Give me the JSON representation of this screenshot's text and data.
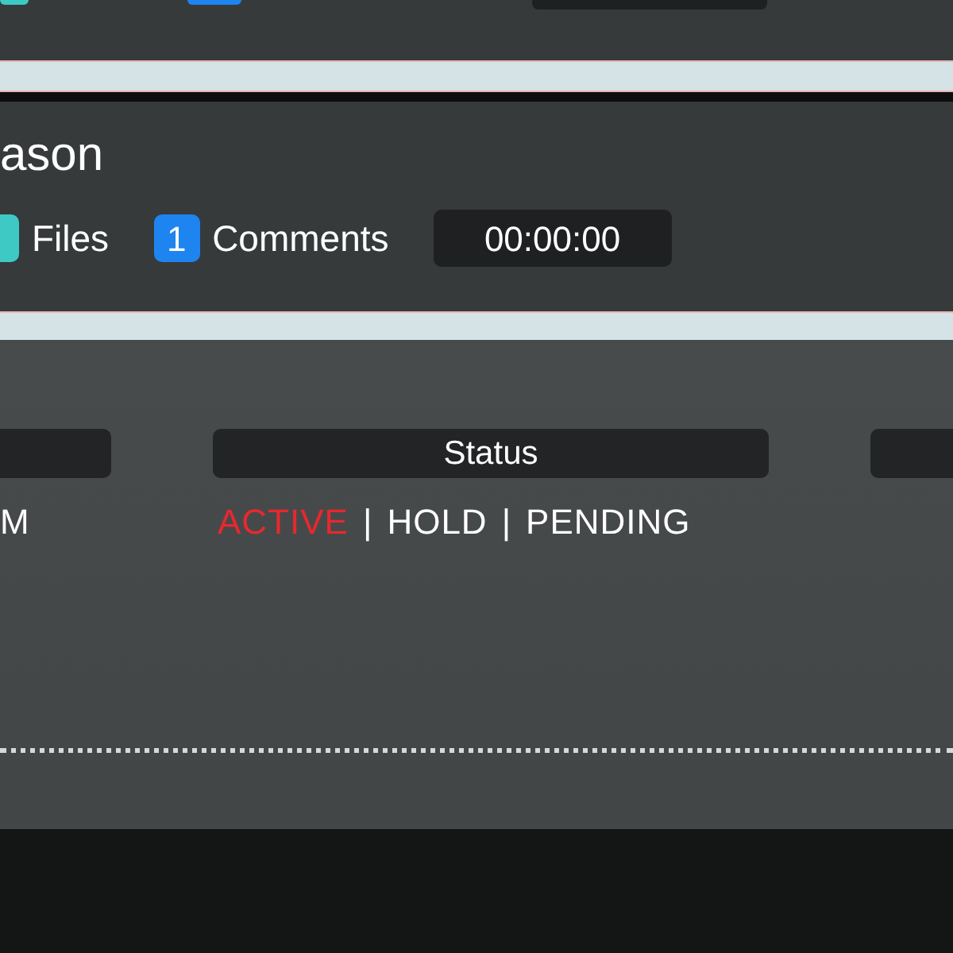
{
  "card": {
    "title": "ason",
    "stats": [
      {
        "kind": "files",
        "label": "Files"
      },
      {
        "kind": "comments",
        "count": "1",
        "label": "Comments"
      }
    ],
    "timer": "00:00:00"
  },
  "table": {
    "columns": [
      {},
      {
        "label": "Status"
      },
      {}
    ],
    "row": {
      "column_1": "M",
      "status_options": [
        {
          "label": "ACTIVE",
          "selected": true
        },
        {
          "label": "HOLD",
          "selected": false
        },
        {
          "label": "PENDING",
          "selected": false
        }
      ],
      "separator": "|"
    }
  }
}
